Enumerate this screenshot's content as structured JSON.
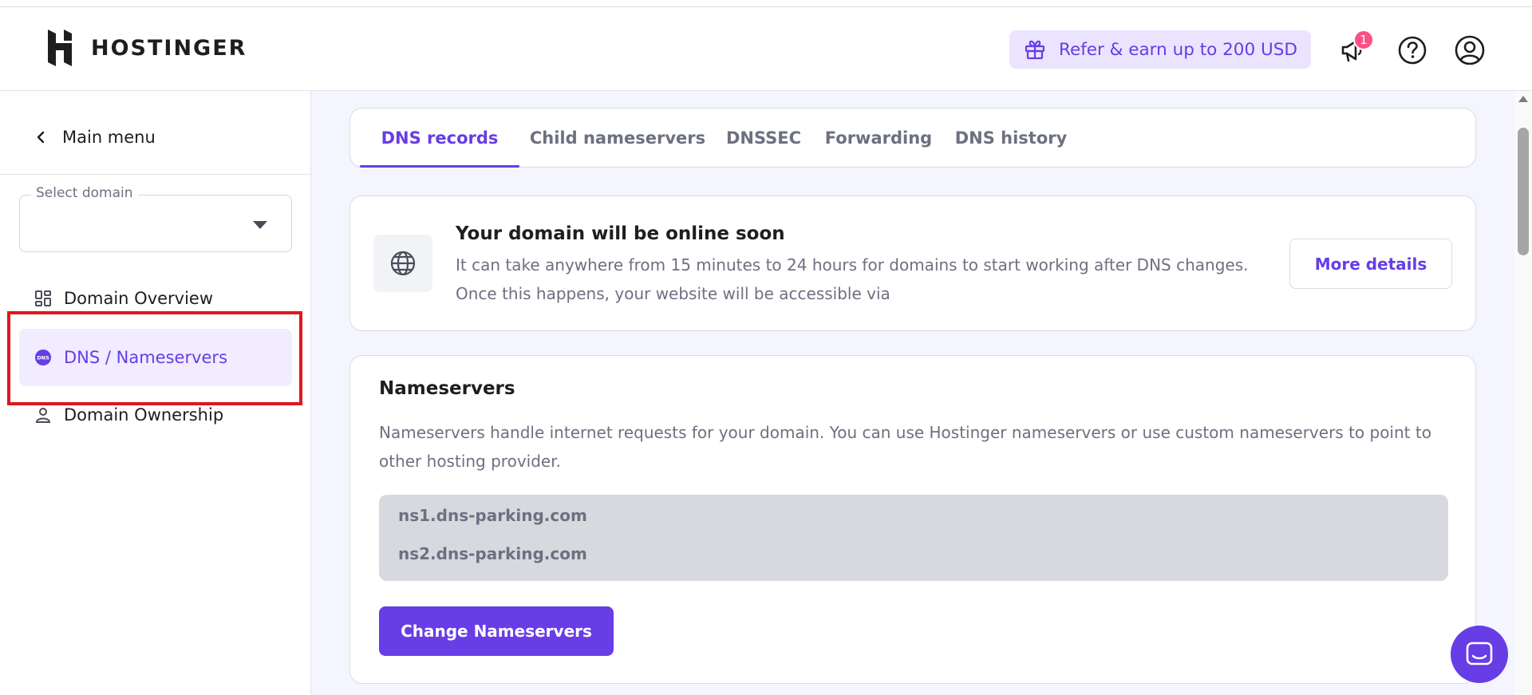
{
  "header": {
    "logo_text": "HOSTINGER",
    "refer_label": "Refer & earn up to 200 USD",
    "notification_count": "1"
  },
  "sidebar": {
    "main_menu_label": "Main menu",
    "select_domain_label": "Select domain",
    "select_domain_value": "",
    "items": [
      {
        "label": "Domain Overview",
        "icon": "grid-icon",
        "active": false
      },
      {
        "label": "DNS / Nameservers",
        "icon": "dns-icon",
        "active": true
      },
      {
        "label": "Domain Ownership",
        "icon": "user-icon",
        "active": false
      }
    ]
  },
  "tabs": [
    {
      "label": "DNS records",
      "active": true
    },
    {
      "label": "Child nameservers",
      "active": false
    },
    {
      "label": "DNSSEC",
      "active": false
    },
    {
      "label": "Forwarding",
      "active": false
    },
    {
      "label": "DNS history",
      "active": false
    }
  ],
  "online_notice": {
    "title": "Your domain will be online soon",
    "text": "It can take anywhere from 15 minutes to 24 hours for domains to start working after DNS changes. Once this happens, your website will be accessible via",
    "button_label": "More details"
  },
  "nameservers": {
    "title": "Nameservers",
    "description": "Nameservers handle internet requests for your domain. You can use Hostinger nameservers or use custom nameservers to point to other hosting provider.",
    "servers": [
      "ns1.dns-parking.com",
      "ns2.dns-parking.com"
    ],
    "change_button_label": "Change Nameservers"
  },
  "colors": {
    "accent": "#673de6",
    "accent_light": "#ebe4ff",
    "badge": "#fc5185",
    "highlight": "#e0161c"
  }
}
